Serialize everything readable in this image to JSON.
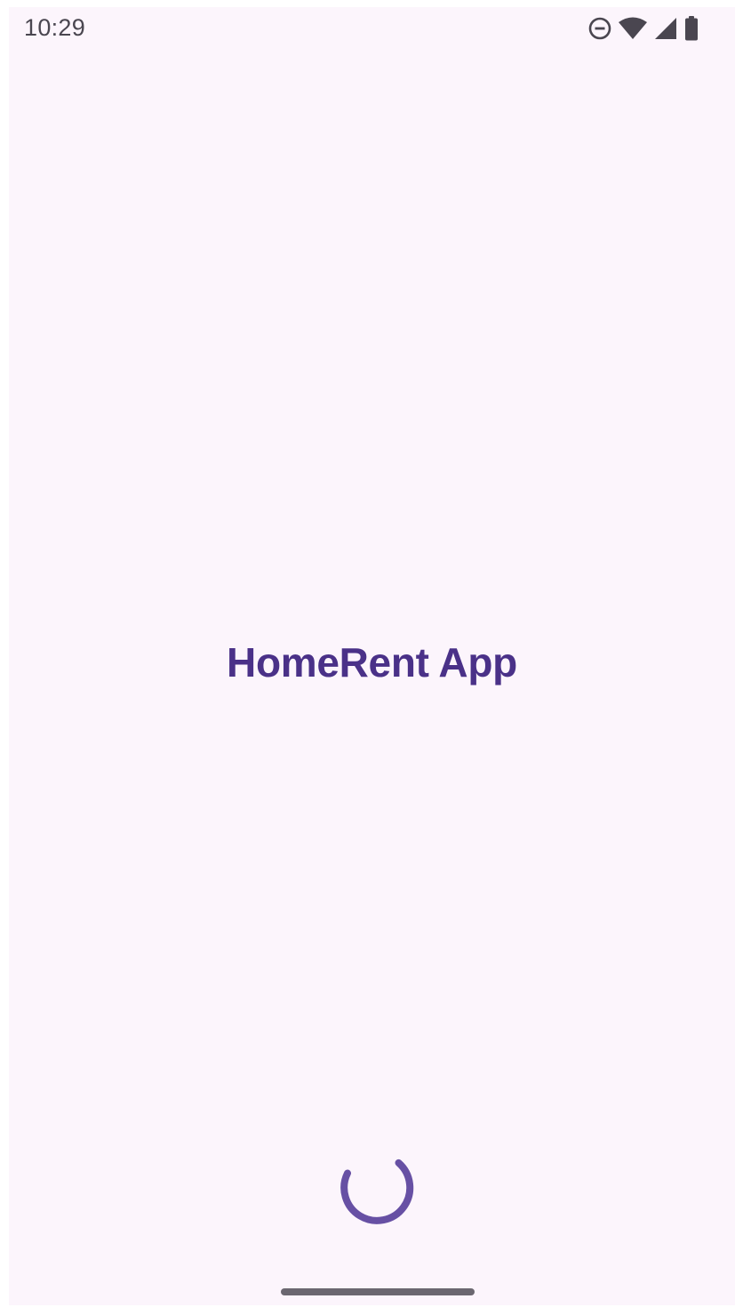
{
  "status_bar": {
    "time": "10:29",
    "icons": [
      "do-not-disturb-icon",
      "wifi-icon",
      "cell-signal-icon",
      "battery-icon"
    ]
  },
  "splash": {
    "title": "HomeRent App",
    "loading": "loading-spinner"
  },
  "colors": {
    "background": "#fcf5fc",
    "title": "#4a3188",
    "spinner": "#6750a4",
    "status_text": "#4a4650",
    "status_icons": "#4a4650",
    "home_indicator": "#6b6770"
  }
}
